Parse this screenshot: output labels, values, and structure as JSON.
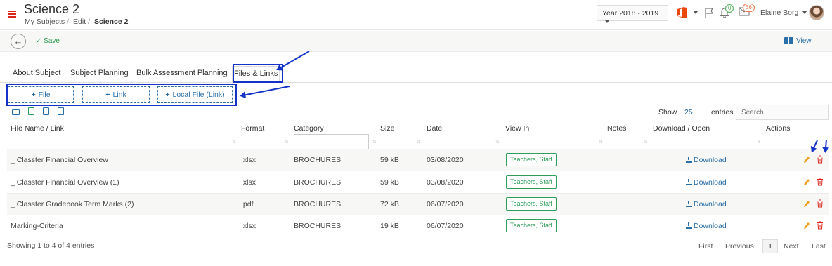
{
  "header": {
    "title": "Science 2",
    "breadcrumb": [
      "My Subjects",
      "Edit",
      "Science 2"
    ],
    "year": "Year 2018 - 2019",
    "notifications_count": "0",
    "messages_count": "36",
    "user_name": "Elaine Borg"
  },
  "toolbar": {
    "save_label": "Save",
    "view_label": "View"
  },
  "tabs": [
    {
      "label": "About Subject"
    },
    {
      "label": "Subject Planning"
    },
    {
      "label": "Bulk Assessment Planning"
    },
    {
      "label": "Files & Links"
    }
  ],
  "add_buttons": [
    {
      "label": "File"
    },
    {
      "label": "Link"
    },
    {
      "label": "Local File (Link)"
    }
  ],
  "table_controls": {
    "show_label": "Show",
    "show_value": "25",
    "entries_label": "entries",
    "search_placeholder": "Search..."
  },
  "columns": [
    "File Name / Link",
    "Format",
    "Category",
    "Size",
    "Date",
    "View In",
    "Notes",
    "Download / Open",
    "Actions"
  ],
  "rows": [
    {
      "name": "_ Classter Financial Overview",
      "format": ".xlsx",
      "category": "BROCHURES",
      "size": "59 kB",
      "date": "03/08/2020",
      "view_in": "Teachers, Staff",
      "download": "Download"
    },
    {
      "name": "_ Classter Financial Overview (1)",
      "format": ".xlsx",
      "category": "BROCHURES",
      "size": "59 kB",
      "date": "03/08/2020",
      "view_in": "Teachers, Staff",
      "download": "Download"
    },
    {
      "name": "_ Classter Gradebook Term Marks (2)",
      "format": ".pdf",
      "category": "BROCHURES",
      "size": "72 kB",
      "date": "06/07/2020",
      "view_in": "Teachers, Staff",
      "download": "Download"
    },
    {
      "name": "Marking-Criteria",
      "format": ".xlsx",
      "category": "BROCHURES",
      "size": "19 kB",
      "date": "06/07/2020",
      "view_in": "Teachers, Staff",
      "download": "Download"
    }
  ],
  "footer": {
    "info": "Showing 1 to 4 of 4 entries",
    "first": "First",
    "previous": "Previous",
    "current_page": "1",
    "next": "Next",
    "last": "Last"
  }
}
